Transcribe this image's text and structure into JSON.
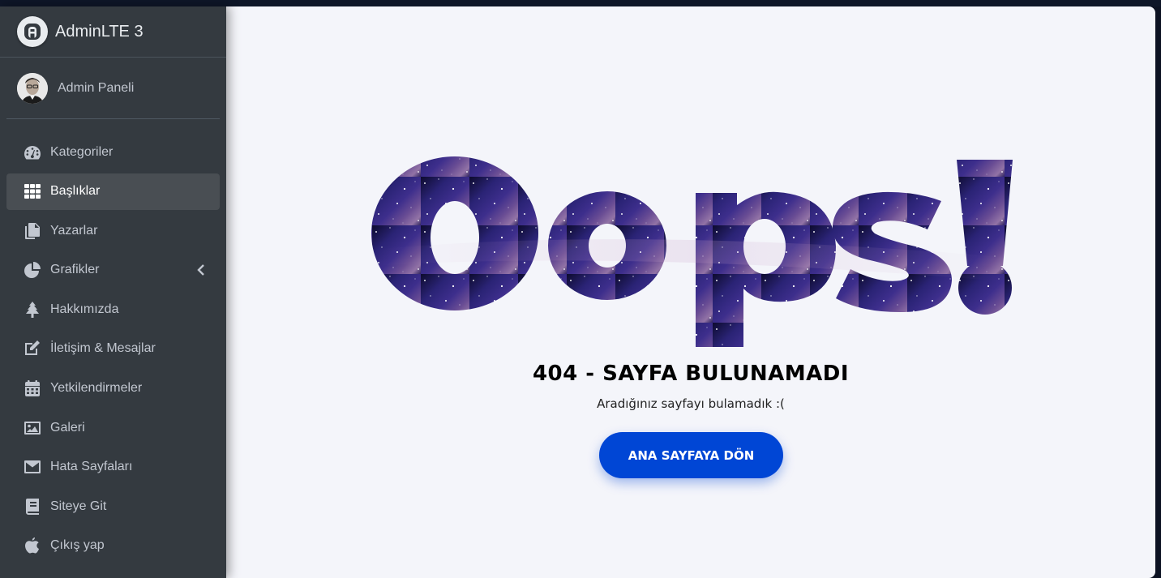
{
  "brand": {
    "name": "AdminLTE 3",
    "logo_icon": "adminlte-logo-icon"
  },
  "user": {
    "name": "Admin Paneli",
    "avatar": "user-avatar"
  },
  "sidebar": {
    "items": [
      {
        "label": "Kategoriler",
        "icon": "tachometer-icon",
        "active": false
      },
      {
        "label": "Başlıklar",
        "icon": "grid-icon",
        "active": true
      },
      {
        "label": "Yazarlar",
        "icon": "copy-icon",
        "active": false
      },
      {
        "label": "Grafikler",
        "icon": "pie-chart-icon",
        "active": false,
        "has_submenu": true
      },
      {
        "label": "Hakkımızda",
        "icon": "tree-icon",
        "active": false
      },
      {
        "label": "İletişim & Mesajlar",
        "icon": "edit-icon",
        "active": false
      },
      {
        "label": "Yetkilendirmeler",
        "icon": "calendar-icon",
        "active": false
      },
      {
        "label": "Galeri",
        "icon": "image-icon",
        "active": false
      },
      {
        "label": "Hata Sayfaları",
        "icon": "envelope-icon",
        "active": false
      },
      {
        "label": "Siteye Git",
        "icon": "book-icon",
        "active": false
      },
      {
        "label": "Çıkış yap",
        "icon": "apple-icon",
        "active": false
      }
    ]
  },
  "error": {
    "headline": "Oops!",
    "title": "404 - SAYFA BULUNAMADI",
    "message": "Aradığınız sayfayı bulamadık :(",
    "button_label": "ANA SAYFAYA DÖN"
  },
  "colors": {
    "sidebar_bg": "#343a40",
    "sidebar_active": "#494e53",
    "content_bg": "#f4f5fa",
    "button_bg": "#0046d5",
    "galaxy_dark": "#1a1650",
    "galaxy_mid": "#3a2d8a",
    "galaxy_light": "#8a6aa8"
  }
}
